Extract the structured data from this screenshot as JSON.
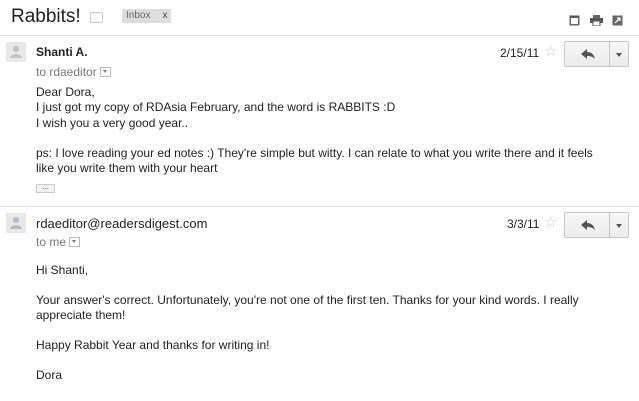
{
  "thread": {
    "subject": "Rabbits!",
    "label": "Inbox",
    "label_remove": "x"
  },
  "icons": {
    "new_window": "new-window-icon",
    "print": "print-icon",
    "expand": "expand-all-icon",
    "star": "star-icon",
    "reply": "reply-icon",
    "more": "chevron-down-icon",
    "avatar": "person-icon"
  },
  "messages": [
    {
      "sender": "Shanti A.",
      "to": "to rdaeditor",
      "date": "2/15/11",
      "body": [
        "Dear Dora,",
        "I just got my copy of RDAsia February, and the word is RABBITS :D",
        "I wish you a very good year..",
        "",
        "ps: I love reading your ed notes :) They're simple but witty. I can relate to what you write there and it feels",
        "like you write them with your heart"
      ],
      "show_trimmed": "..."
    },
    {
      "sender": "rdaeditor@readersdigest.com",
      "to": "to me",
      "date": "3/3/11",
      "body": [
        "Hi Shanti,",
        "",
        "Your answer's correct. Unfortunately, you're not one of the first ten. Thanks for your kind words. I really",
        "appreciate them!",
        "",
        "Happy Rabbit Year and thanks for writing in!",
        "",
        "Dora"
      ]
    }
  ],
  "colors": {
    "divider": "#e3e3e3",
    "button_border": "#c6c6c6",
    "label_bg": "#dddddd"
  }
}
